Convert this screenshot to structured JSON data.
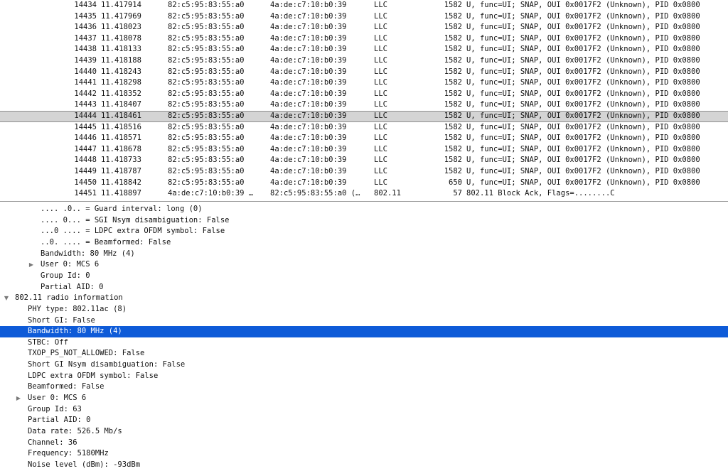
{
  "packets": [
    {
      "no": "14434",
      "time": "11.417914",
      "source": "82:c5:95:83:55:a0",
      "destination": "4a:de:c7:10:b0:39",
      "protocol": "LLC",
      "length": "1582",
      "info": "U, func=UI; SNAP, OUI 0x0017F2 (Unknown), PID 0x0800"
    },
    {
      "no": "14435",
      "time": "11.417969",
      "source": "82:c5:95:83:55:a0",
      "destination": "4a:de:c7:10:b0:39",
      "protocol": "LLC",
      "length": "1582",
      "info": "U, func=UI; SNAP, OUI 0x0017F2 (Unknown), PID 0x0800"
    },
    {
      "no": "14436",
      "time": "11.418023",
      "source": "82:c5:95:83:55:a0",
      "destination": "4a:de:c7:10:b0:39",
      "protocol": "LLC",
      "length": "1582",
      "info": "U, func=UI; SNAP, OUI 0x0017F2 (Unknown), PID 0x0800"
    },
    {
      "no": "14437",
      "time": "11.418078",
      "source": "82:c5:95:83:55:a0",
      "destination": "4a:de:c7:10:b0:39",
      "protocol": "LLC",
      "length": "1582",
      "info": "U, func=UI; SNAP, OUI 0x0017F2 (Unknown), PID 0x0800"
    },
    {
      "no": "14438",
      "time": "11.418133",
      "source": "82:c5:95:83:55:a0",
      "destination": "4a:de:c7:10:b0:39",
      "protocol": "LLC",
      "length": "1582",
      "info": "U, func=UI; SNAP, OUI 0x0017F2 (Unknown), PID 0x0800"
    },
    {
      "no": "14439",
      "time": "11.418188",
      "source": "82:c5:95:83:55:a0",
      "destination": "4a:de:c7:10:b0:39",
      "protocol": "LLC",
      "length": "1582",
      "info": "U, func=UI; SNAP, OUI 0x0017F2 (Unknown), PID 0x0800"
    },
    {
      "no": "14440",
      "time": "11.418243",
      "source": "82:c5:95:83:55:a0",
      "destination": "4a:de:c7:10:b0:39",
      "protocol": "LLC",
      "length": "1582",
      "info": "U, func=UI; SNAP, OUI 0x0017F2 (Unknown), PID 0x0800"
    },
    {
      "no": "14441",
      "time": "11.418298",
      "source": "82:c5:95:83:55:a0",
      "destination": "4a:de:c7:10:b0:39",
      "protocol": "LLC",
      "length": "1582",
      "info": "U, func=UI; SNAP, OUI 0x0017F2 (Unknown), PID 0x0800"
    },
    {
      "no": "14442",
      "time": "11.418352",
      "source": "82:c5:95:83:55:a0",
      "destination": "4a:de:c7:10:b0:39",
      "protocol": "LLC",
      "length": "1582",
      "info": "U, func=UI; SNAP, OUI 0x0017F2 (Unknown), PID 0x0800"
    },
    {
      "no": "14443",
      "time": "11.418407",
      "source": "82:c5:95:83:55:a0",
      "destination": "4a:de:c7:10:b0:39",
      "protocol": "LLC",
      "length": "1582",
      "info": "U, func=UI; SNAP, OUI 0x0017F2 (Unknown), PID 0x0800"
    },
    {
      "no": "14444",
      "time": "11.418461",
      "source": "82:c5:95:83:55:a0",
      "destination": "4a:de:c7:10:b0:39",
      "protocol": "LLC",
      "length": "1582",
      "info": "U, func=UI; SNAP, OUI 0x0017F2 (Unknown), PID 0x0800",
      "selected": true
    },
    {
      "no": "14445",
      "time": "11.418516",
      "source": "82:c5:95:83:55:a0",
      "destination": "4a:de:c7:10:b0:39",
      "protocol": "LLC",
      "length": "1582",
      "info": "U, func=UI; SNAP, OUI 0x0017F2 (Unknown), PID 0x0800"
    },
    {
      "no": "14446",
      "time": "11.418571",
      "source": "82:c5:95:83:55:a0",
      "destination": "4a:de:c7:10:b0:39",
      "protocol": "LLC",
      "length": "1582",
      "info": "U, func=UI; SNAP, OUI 0x0017F2 (Unknown), PID 0x0800"
    },
    {
      "no": "14447",
      "time": "11.418678",
      "source": "82:c5:95:83:55:a0",
      "destination": "4a:de:c7:10:b0:39",
      "protocol": "LLC",
      "length": "1582",
      "info": "U, func=UI; SNAP, OUI 0x0017F2 (Unknown), PID 0x0800"
    },
    {
      "no": "14448",
      "time": "11.418733",
      "source": "82:c5:95:83:55:a0",
      "destination": "4a:de:c7:10:b0:39",
      "protocol": "LLC",
      "length": "1582",
      "info": "U, func=UI; SNAP, OUI 0x0017F2 (Unknown), PID 0x0800"
    },
    {
      "no": "14449",
      "time": "11.418787",
      "source": "82:c5:95:83:55:a0",
      "destination": "4a:de:c7:10:b0:39",
      "protocol": "LLC",
      "length": "1582",
      "info": "U, func=UI; SNAP, OUI 0x0017F2 (Unknown), PID 0x0800"
    },
    {
      "no": "14450",
      "time": "11.418842",
      "source": "82:c5:95:83:55:a0",
      "destination": "4a:de:c7:10:b0:39",
      "protocol": "LLC",
      "length": "650",
      "info": "U, func=UI; SNAP, OUI 0x0017F2 (Unknown), PID 0x0800"
    },
    {
      "no": "14451",
      "time": "11.418897",
      "source": "4a:de:c7:10:b0:39 …",
      "destination": "82:c5:95:83:55:a0 (…",
      "protocol": "802.11",
      "length": "57",
      "info": "802.11 Block Ack, Flags=........C"
    }
  ],
  "details": [
    {
      "text": ".... .0.. = Guard interval: long (0)",
      "level": 2
    },
    {
      "text": ".... 0... = SGI Nsym disambiguation: False",
      "level": 2
    },
    {
      "text": "...0 .... = LDPC extra OFDM symbol: False",
      "level": 2
    },
    {
      "text": "..0. .... = Beamformed: False",
      "level": 2
    },
    {
      "text": "Bandwidth: 80 MHz (4)",
      "level": 2
    },
    {
      "text": "User 0: MCS 6",
      "level": 2,
      "expander": "collapsed"
    },
    {
      "text": "Group Id: 0",
      "level": 2
    },
    {
      "text": "Partial AID: 0",
      "level": 2
    },
    {
      "text": "802.11 radio information",
      "level": 0,
      "expander": "expanded"
    },
    {
      "text": "PHY type: 802.11ac (8)",
      "level": 1
    },
    {
      "text": "Short GI: False",
      "level": 1
    },
    {
      "text": "Bandwidth: 80 MHz (4)",
      "level": 1,
      "selected": true
    },
    {
      "text": "STBC: Off",
      "level": 1
    },
    {
      "text": "TXOP_PS_NOT_ALLOWED: False",
      "level": 1
    },
    {
      "text": "Short GI Nsym disambiguation: False",
      "level": 1
    },
    {
      "text": "LDPC extra OFDM symbol: False",
      "level": 1
    },
    {
      "text": "Beamformed: False",
      "level": 1
    },
    {
      "text": "User 0: MCS 6",
      "level": 1,
      "expander": "collapsed"
    },
    {
      "text": "Group Id: 63",
      "level": 1
    },
    {
      "text": "Partial AID: 0",
      "level": 1
    },
    {
      "text": "Data rate: 526.5 Mb/s",
      "level": 1
    },
    {
      "text": "Channel: 36",
      "level": 1
    },
    {
      "text": "Frequency: 5180MHz",
      "level": 1
    },
    {
      "text": "Noise level (dBm): -93dBm",
      "level": 1
    }
  ],
  "icons": {
    "collapsed": "triangle-right-icon",
    "expanded": "triangle-down-icon"
  },
  "colors": {
    "selection_blue": "#0e5bd8",
    "packet_selected_gray": "#d4d4d4"
  }
}
